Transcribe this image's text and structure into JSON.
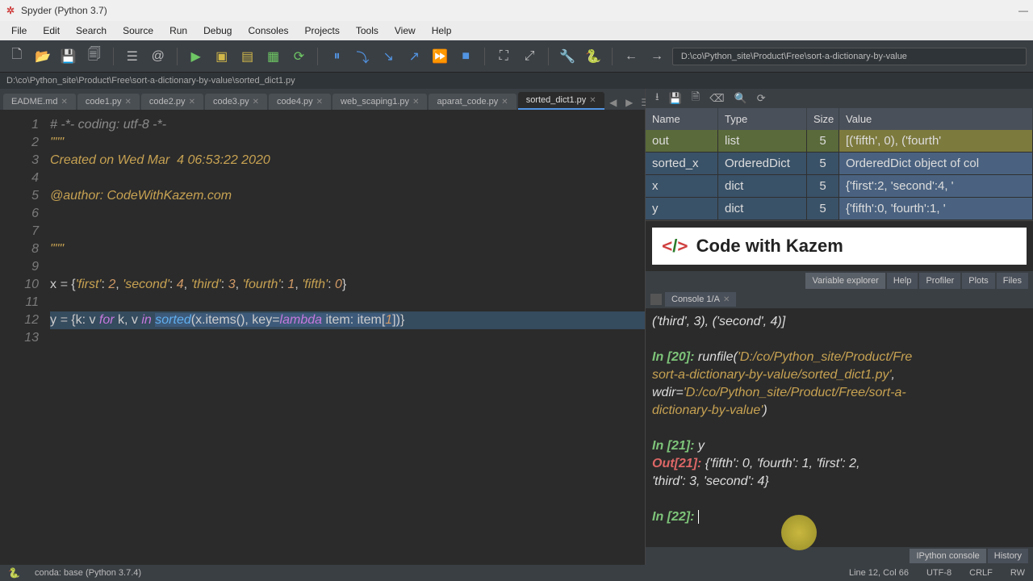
{
  "window": {
    "title": "Spyder (Python 3.7)"
  },
  "menu": [
    "File",
    "Edit",
    "Search",
    "Source",
    "Run",
    "Debug",
    "Consoles",
    "Projects",
    "Tools",
    "View",
    "Help"
  ],
  "toolbar_path": "D:\\co\\Python_site\\Product\\Free\\sort-a-dictionary-by-value",
  "breadcrumb": "D:\\co\\Python_site\\Product\\Free\\sort-a-dictionary-by-value\\sorted_dict1.py",
  "editor_tabs": [
    "EADME.md",
    "code1.py",
    "code2.py",
    "code3.py",
    "code4.py",
    "web_scaping1.py",
    "aparat_code.py",
    "sorted_dict1.py"
  ],
  "active_tab": "sorted_dict1.py",
  "code_lines": [
    {
      "n": 1,
      "html": "<span class='c-comment'># -*- coding: utf-8 -*-</span>"
    },
    {
      "n": 2,
      "html": "<span class='c-str'>\"\"\"</span>"
    },
    {
      "n": 3,
      "html": "<span class='c-str'>Created on Wed Mar  4 06:53:22 2020</span>"
    },
    {
      "n": 4,
      "html": ""
    },
    {
      "n": 5,
      "html": "<span class='c-str'>@author: CodeWithKazem.com</span>"
    },
    {
      "n": 6,
      "html": ""
    },
    {
      "n": 7,
      "html": ""
    },
    {
      "n": 8,
      "html": "<span class='c-str'>\"\"\"</span>"
    },
    {
      "n": 9,
      "html": ""
    },
    {
      "n": 10,
      "html": "x <span class='c-op'>=</span> {<span class='c-str'>'first'</span>: <span class='c-num'>2</span>, <span class='c-str'>'second'</span>: <span class='c-num'>4</span>, <span class='c-str'>'third'</span>: <span class='c-num'>3</span>, <span class='c-str'>'fourth'</span>: <span class='c-num'>1</span>, <span class='c-str'>'fifth'</span>: <span class='c-num'>0</span>}"
    },
    {
      "n": 11,
      "html": ""
    },
    {
      "n": 12,
      "hl": true,
      "html": "y <span class='c-op'>=</span> {k: v <span class='c-kw'>for</span> k, v <span class='c-kw'>in</span> <span class='c-hl-sel'><span class='c-fn'>sorted</span>(x.items(), key=<span class='c-kw'>lambda</span> item: item[<span class='c-num'>1</span>])</span>}"
    },
    {
      "n": 13,
      "html": ""
    }
  ],
  "var_headers": [
    "Name",
    "Type",
    "Size",
    "Value"
  ],
  "vars": [
    {
      "name": "out",
      "type": "list",
      "size": "5",
      "value": "[('fifth', 0), ('fourth'"
    },
    {
      "name": "sorted_x",
      "type": "OrderedDict",
      "size": "5",
      "value": "OrderedDict object of col"
    },
    {
      "name": "x",
      "type": "dict",
      "size": "5",
      "value": "{'first':2, 'second':4, '"
    },
    {
      "name": "y",
      "type": "dict",
      "size": "5",
      "value": "{'fifth':0, 'fourth':1, '"
    }
  ],
  "right_tabs": [
    "Variable explorer",
    "Help",
    "Profiler",
    "Plots",
    "Files"
  ],
  "banner_text": "Code with Kazem",
  "console_tab": "Console 1/A",
  "console_content": {
    "line0": "('third', 3), ('second', 4)]",
    "in20": "In [20]:",
    "runfile": "runfile(",
    "runfile_path": "'D:/co/Python_site/Product/Fre",
    "runfile_path2": "sort-a-dictionary-by-value/sorted_dict1.py'",
    "wdir": "wdir=",
    "wdir_path": "'D:/co/Python_site/Product/Free/sort-a-",
    "wdir_path2": "dictionary-by-value'",
    "in21": "In [21]:",
    "in21_cmd": "y",
    "out21": "Out[21]:",
    "out21_val": "{'fifth': 0, 'fourth': 1, 'first': 2,",
    "out21_val2": "'third': 3, 'second': 4}",
    "in22": "In [22]:"
  },
  "console_bottom_tabs": [
    "IPython console",
    "History"
  ],
  "status": {
    "env": "conda: base (Python 3.7.4)",
    "pos": "Line 12, Col 66",
    "enc": "UTF-8",
    "eol": "CRLF",
    "rw": "RW"
  }
}
